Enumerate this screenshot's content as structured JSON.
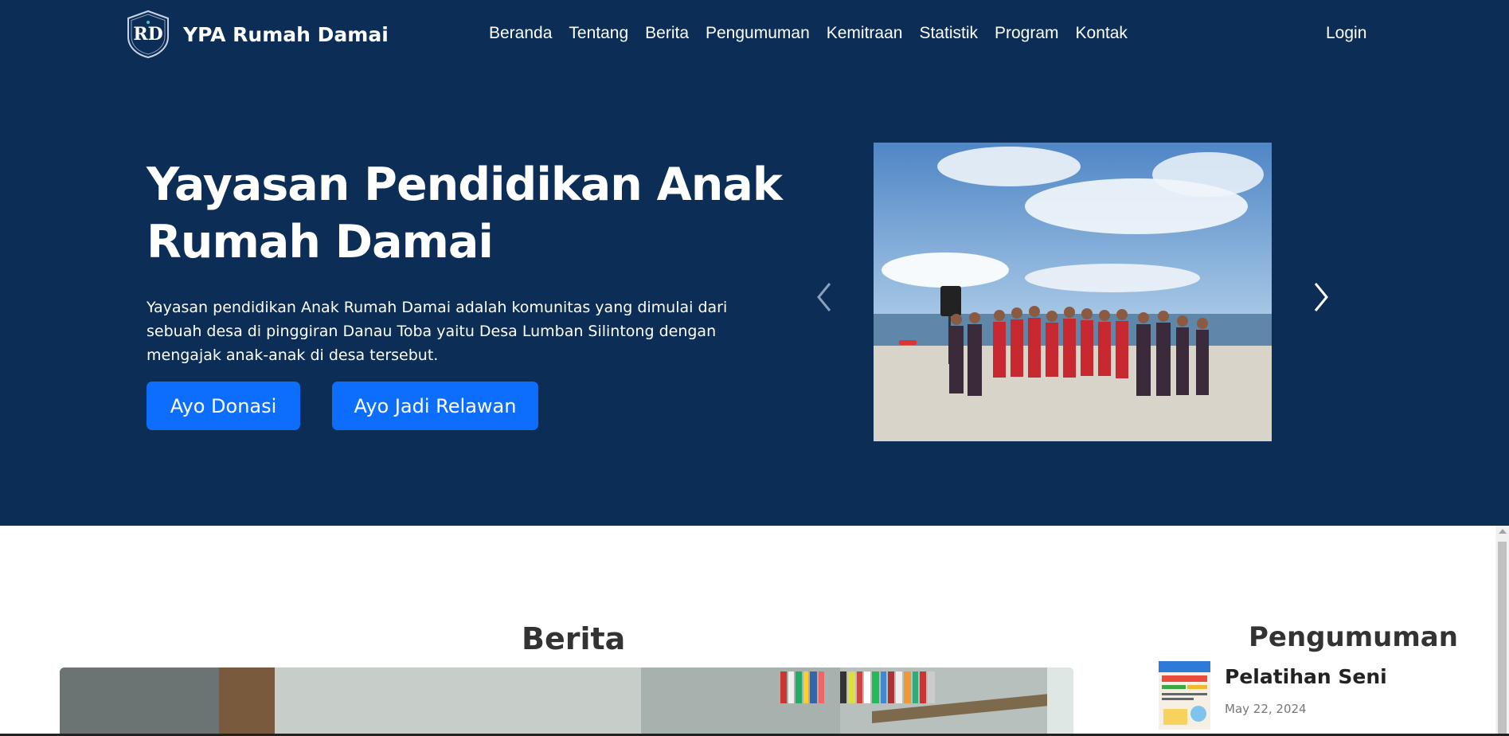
{
  "brand": {
    "name": "YPA Rumah Damai",
    "logo_icon": "rd-shield-logo-icon"
  },
  "nav": {
    "items": [
      "Beranda",
      "Tentang",
      "Berita",
      "Pengumuman",
      "Kemitraan",
      "Statistik",
      "Program",
      "Kontak"
    ],
    "login": "Login"
  },
  "hero": {
    "title": "Yayasan Pendidikan Anak Rumah Damai",
    "description": "Yayasan pendidikan Anak Rumah Damai adalah komunitas yang dimulai dari sebuah desa di pinggiran Danau Toba yaitu Desa Lumban Silintong dengan mengajak anak-anak di desa tersebut.",
    "donate_button": "Ayo Donasi",
    "volunteer_button": "Ayo Jadi Relawan",
    "carousel": {
      "prev_icon": "chevron-left-icon",
      "next_icon": "chevron-right-icon"
    }
  },
  "berita": {
    "title": "Berita"
  },
  "pengumuman": {
    "title": "Pengumuman",
    "items": [
      {
        "title": "Pelatihan Seni",
        "date": "May 22, 2024"
      }
    ]
  },
  "colors": {
    "navy": "#0b2d56",
    "primary": "#0d6efd",
    "heading": "#333333"
  }
}
